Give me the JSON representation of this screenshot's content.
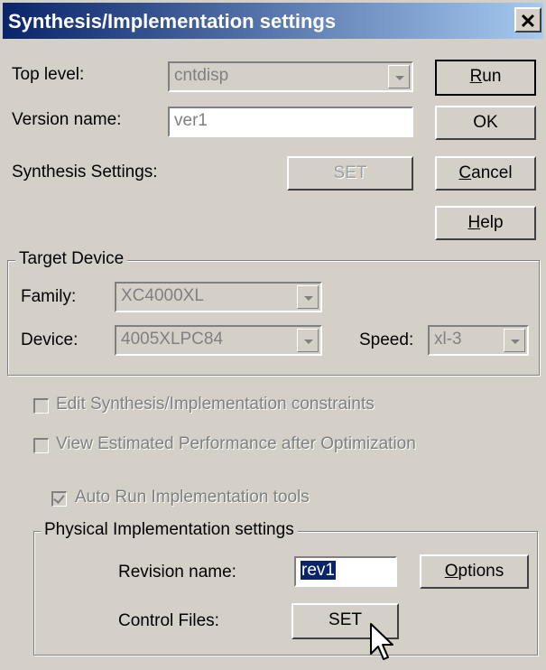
{
  "dialog": {
    "title": "Synthesis/Implementation settings",
    "close_label": "✕"
  },
  "top_level": {
    "label": "Top level:",
    "value": "cntdisp"
  },
  "version": {
    "label": "Version name:",
    "value": "ver1"
  },
  "synthesis_settings": {
    "label": "Synthesis Settings:",
    "button": "SET"
  },
  "buttons": {
    "run": "Run",
    "run_key": "R",
    "run_rest": "un",
    "ok": "OK",
    "cancel_key": "C",
    "cancel_rest": "ancel",
    "help_key": "H",
    "help_rest": "elp"
  },
  "target_device": {
    "title": "Target Device",
    "family_label": "Family:",
    "family_value": "XC4000XL",
    "device_label": "Device:",
    "device_value": "4005XLPC84",
    "speed_label": "Speed:",
    "speed_value": "xl-3"
  },
  "options": {
    "edit_constraints": "Edit Synthesis/Implementation constraints",
    "view_performance": "View Estimated Performance after Optimization",
    "auto_run": "Auto Run Implementation tools"
  },
  "physical": {
    "title": "Physical Implementation settings",
    "revision_label": "Revision name:",
    "revision_value": "rev1",
    "options_key": "O",
    "options_rest": "ptions",
    "control_label": "Control Files:",
    "control_button": "SET"
  }
}
